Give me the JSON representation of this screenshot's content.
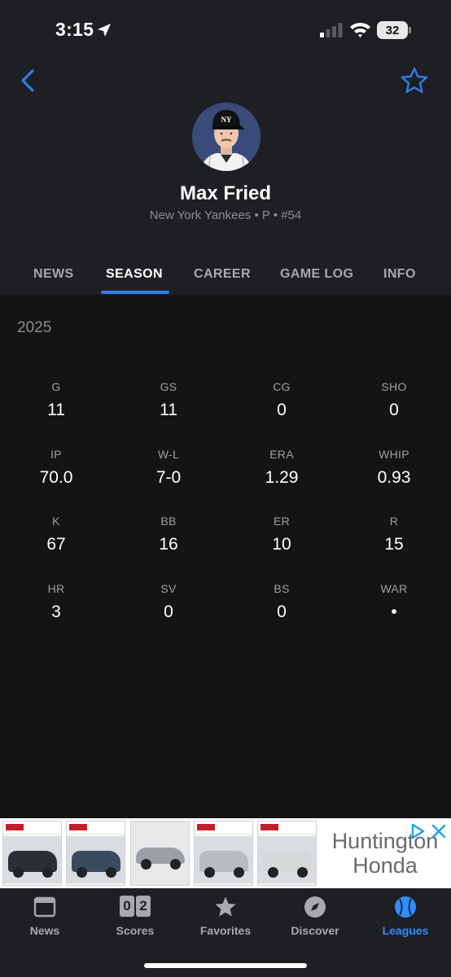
{
  "status_bar": {
    "time": "3:15",
    "battery": "32"
  },
  "player": {
    "name": "Max Fried",
    "subtitle": "New York Yankees • P • #54"
  },
  "tabs": [
    {
      "label": "NEWS",
      "active": false
    },
    {
      "label": "SEASON",
      "active": true
    },
    {
      "label": "CAREER",
      "active": false
    },
    {
      "label": "GAME LOG",
      "active": false
    },
    {
      "label": "INFO",
      "active": false
    }
  ],
  "season": {
    "year": "2025",
    "stats": [
      {
        "label": "G",
        "value": "11"
      },
      {
        "label": "GS",
        "value": "11"
      },
      {
        "label": "CG",
        "value": "0"
      },
      {
        "label": "SHO",
        "value": "0"
      },
      {
        "label": "IP",
        "value": "70.0"
      },
      {
        "label": "W-L",
        "value": "7-0"
      },
      {
        "label": "ERA",
        "value": "1.29"
      },
      {
        "label": "WHIP",
        "value": "0.93"
      },
      {
        "label": "K",
        "value": "67"
      },
      {
        "label": "BB",
        "value": "16"
      },
      {
        "label": "ER",
        "value": "10"
      },
      {
        "label": "R",
        "value": "15"
      },
      {
        "label": "HR",
        "value": "3"
      },
      {
        "label": "SV",
        "value": "0"
      },
      {
        "label": "BS",
        "value": "0"
      },
      {
        "label": "WAR",
        "value": "•"
      }
    ]
  },
  "ad": {
    "brand_line1": "Huntington",
    "brand_line2": "Honda",
    "thumbs": [
      {
        "car_color": "#2a2f36"
      },
      {
        "car_color": "#3b4a5c"
      },
      {
        "car_color": "#9aa0a6"
      },
      {
        "car_color": "#b8bcc0"
      },
      {
        "car_color": "#d6d8da"
      }
    ]
  },
  "bottom_nav": {
    "scores_digits": [
      "0",
      "2"
    ],
    "items": [
      {
        "label": "News",
        "active": false
      },
      {
        "label": "Scores",
        "active": false
      },
      {
        "label": "Favorites",
        "active": false
      },
      {
        "label": "Discover",
        "active": false
      },
      {
        "label": "Leagues",
        "active": true
      }
    ]
  },
  "colors": {
    "accent": "#2f7dea",
    "header_bg": "#1e1f22",
    "body_bg": "#141414",
    "active_tab_text": "#ffffff",
    "inactive_text": "#a8a8ad"
  },
  "icons": {
    "back": "chevron-left-icon",
    "favorite": "star-outline-icon",
    "location": "location-arrow-icon",
    "signal": "cellular-signal-icon",
    "wifi": "wifi-icon",
    "ad_choices": "ad-choices-icon",
    "ad_close": "close-icon",
    "nav_news": "newspaper-icon",
    "nav_scores": "scoreboard-icon",
    "nav_favorites": "star-filled-icon",
    "nav_discover": "compass-icon",
    "nav_leagues": "baseball-icon"
  }
}
